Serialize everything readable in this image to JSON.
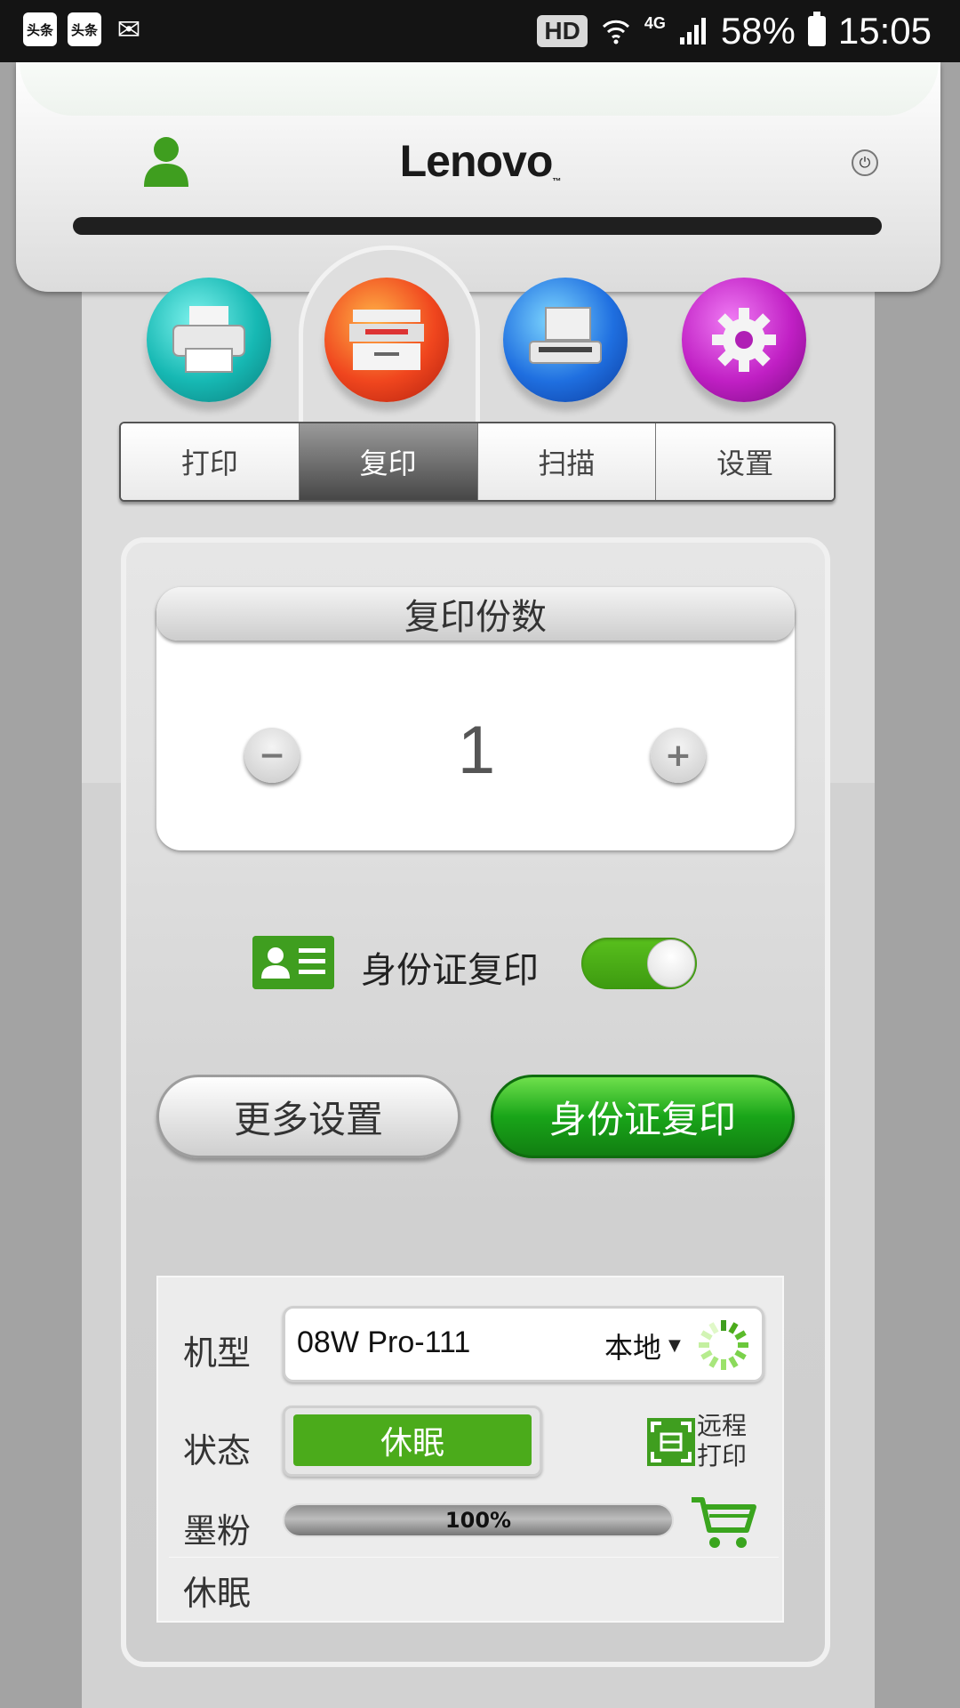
{
  "status_bar": {
    "app_icon_1": "头条",
    "app_icon_2": "头条",
    "hd": "HD",
    "network": "4G",
    "battery": "58%",
    "time": "15:05"
  },
  "header": {
    "brand": "Lenovo",
    "brand_mark": "™"
  },
  "tabs": [
    {
      "label": "打印",
      "icon": "printer-icon",
      "color": "#1fc8c3"
    },
    {
      "label": "复印",
      "icon": "copier-icon",
      "color": "#ee4a20"
    },
    {
      "label": "扫描",
      "icon": "scanner-icon",
      "color": "#1f6fe0"
    },
    {
      "label": "设置",
      "icon": "gear-icon",
      "color": "#c01fc4"
    }
  ],
  "active_tab": "复印",
  "copies": {
    "title": "复印份数",
    "value": "1",
    "minus": "−",
    "plus": "+"
  },
  "id_copy": {
    "label": "身份证复印",
    "enabled": true
  },
  "buttons": {
    "more_settings": "更多设置",
    "id_copy_action": "身份证复印"
  },
  "device": {
    "model_label": "机型",
    "model_value": "08W Pro-111",
    "connection": "本地",
    "status_label": "状态",
    "status_value": "休眠",
    "remote_print": "远程打印",
    "toner_label": "墨粉",
    "toner_value": "100%",
    "toner_level": 1.0,
    "state_text": "休眠"
  },
  "colors": {
    "accent_green": "#4bab1b",
    "button_green": "#19a519"
  }
}
